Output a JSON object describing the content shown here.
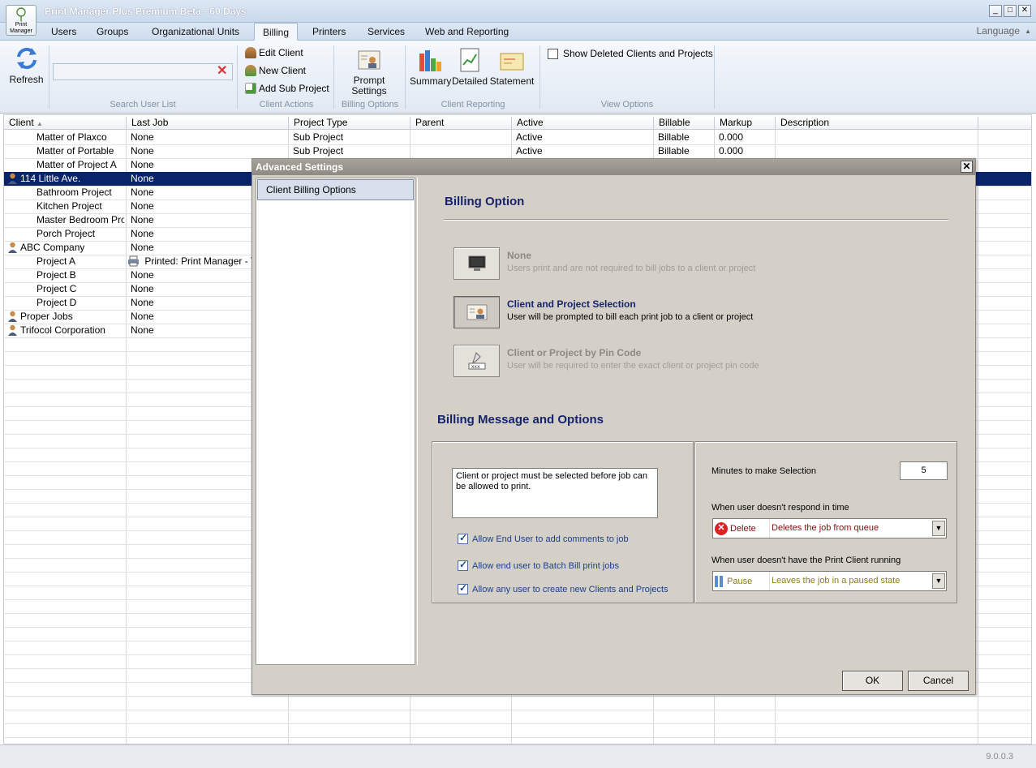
{
  "window": {
    "title": "Print Manager Plus Premium Beta - 60 Days",
    "logo_text": "Print Manager"
  },
  "tabs": [
    {
      "label": "Users"
    },
    {
      "label": "Groups"
    },
    {
      "label": "Organizational Units"
    },
    {
      "label": "Billing"
    },
    {
      "label": "Printers"
    },
    {
      "label": "Services"
    },
    {
      "label": "Web and Reporting"
    }
  ],
  "language": "Language",
  "ribbon": {
    "refresh": "Refresh",
    "search_group": "Search User List",
    "search_placeholder": "",
    "edit_client": "Edit Client",
    "new_client": "New Client",
    "add_sub_project": "Add Sub Project",
    "client_actions_group": "Client Actions",
    "prompt_settings": "Prompt Settings",
    "billing_options_group": "Billing Options",
    "summary": "Summary",
    "detailed": "Detailed",
    "statement": "Statement",
    "client_reporting_group": "Client Reporting",
    "show_deleted": "Show Deleted Clients and Projects",
    "view_options_group": "View Options"
  },
  "grid": {
    "headers": [
      "Client",
      "Last Job",
      "Project Type",
      "Parent",
      "Active",
      "Billable",
      "Markup",
      "Description"
    ],
    "rows": [
      {
        "client": "Matter of Plaxco",
        "last_job": "None",
        "type": "Sub Project",
        "active": "Active",
        "billable": "Billable",
        "markup": "0.000"
      },
      {
        "client": "Matter of Portable",
        "last_job": "None",
        "type": "Sub Project",
        "active": "Active",
        "billable": "Billable",
        "markup": "0.000"
      },
      {
        "client": "Matter of Project A",
        "last_job": "None"
      },
      {
        "client": "114 Little Ave.",
        "last_job": "None"
      },
      {
        "client": "Bathroom Project",
        "last_job": "None"
      },
      {
        "client": "Kitchen Project",
        "last_job": "None"
      },
      {
        "client": "Master Bedroom Proj...",
        "last_job": "None"
      },
      {
        "client": "Porch Project",
        "last_job": "None"
      },
      {
        "client": "ABC Company",
        "last_job": "None"
      },
      {
        "client": "Project A",
        "last_job": "Printed: Print Manager - The"
      },
      {
        "client": "Project B",
        "last_job": "None"
      },
      {
        "client": "Project C",
        "last_job": "None"
      },
      {
        "client": "Project D",
        "last_job": "None"
      },
      {
        "client": "Proper Jobs",
        "last_job": "None"
      },
      {
        "client": "Trifocol Corporation",
        "last_job": "None"
      }
    ]
  },
  "version": "9.0.0.3",
  "dialog": {
    "title": "Advanced Settings",
    "nav_item": "Client Billing Options",
    "billing_option_heading": "Billing Option",
    "options": [
      {
        "title": "None",
        "desc": "Users print and are not required to bill jobs to a client or project"
      },
      {
        "title": "Client and Project Selection",
        "desc": "User will be prompted to bill each print job to a client or project"
      },
      {
        "title": "Client or Project by Pin Code",
        "desc": "User will be required to enter the exact client or project pin code"
      }
    ],
    "message_heading": "Billing Message and Options",
    "message_text": "Client or project must be selected before job can be allowed to print.",
    "checks": [
      "Allow End User to add comments to job",
      "Allow end user to Batch Bill print jobs",
      "Allow any user to create new Clients and Projects"
    ],
    "minutes_label": "Minutes to make Selection",
    "minutes_value": "5",
    "no_response_label": "When user doesn't respond in time",
    "no_response_action": "Delete",
    "no_response_desc": "Deletes the job from queue",
    "no_client_label": "When user doesn't have the Print Client running",
    "no_client_action": "Pause",
    "no_client_desc": "Leaves the job in a paused state",
    "ok": "OK",
    "cancel": "Cancel"
  }
}
